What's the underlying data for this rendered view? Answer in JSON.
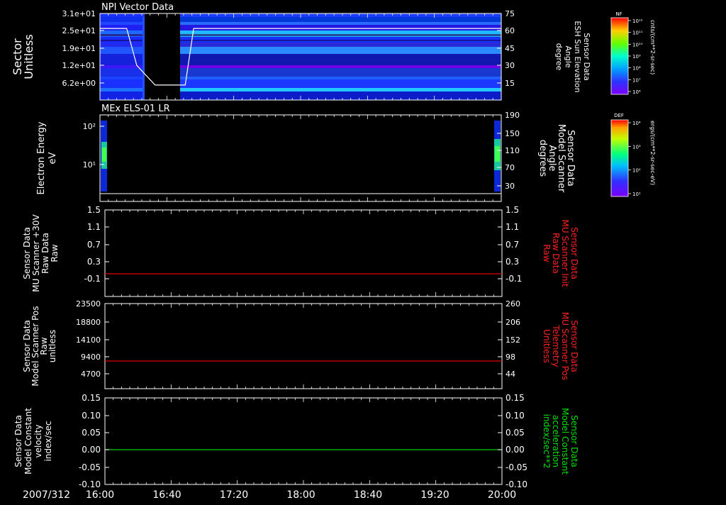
{
  "date_label": "2007/312",
  "time_ticks": [
    "16:00",
    "16:40",
    "17:20",
    "18:00",
    "18:40",
    "19:20",
    "20:00"
  ],
  "colors": {
    "background": "#000000",
    "axes": "#ffffff",
    "red_line": "#dd0000",
    "green_line": "#00cc00",
    "red_label": "#ff2020",
    "green_label": "#00e000"
  },
  "colorbars": [
    {
      "title": "NF",
      "ticks": [
        "10¹²",
        "10¹¹",
        "10¹⁰",
        "10⁹",
        "10⁸",
        "10⁷",
        "10⁶"
      ],
      "unit": "cnts/(cm**2-sr-sec)"
    },
    {
      "title": "DEF",
      "ticks": [
        "10⁴",
        "10³",
        "10²",
        "10¹"
      ],
      "unit": "ergs/(cm**2-sr-sec-eV)"
    }
  ],
  "panels": [
    {
      "title": "NPI Vector Data",
      "left_label": [
        "Sector",
        "Unitless"
      ],
      "left_ticks": [
        "3.1e+01",
        "2.5e+01",
        "1.9e+01",
        "1.2e+01",
        "6.2e+00"
      ],
      "right_ticks": [
        "75",
        "60",
        "45",
        "30",
        "15"
      ],
      "right_label": [
        "Sensor Data",
        "ESH Sun Elevation",
        "Angle",
        "degree"
      ]
    },
    {
      "title": "MEx ELS-01 LR",
      "left_label": [
        "Electron Energy",
        "eV"
      ],
      "left_ticks": [
        "10²",
        "10¹"
      ],
      "right_ticks": [
        "190",
        "150",
        "110",
        "70",
        "30"
      ],
      "right_label": [
        "Sensor Data",
        "Model Scanner",
        "Angle",
        "degrees"
      ]
    },
    {
      "title": "",
      "left_label": [
        "Sensor Data",
        "MU Scanner +30V",
        "Raw Data",
        "Raw"
      ],
      "left_ticks": [
        "1.5",
        "1.1",
        "0.7",
        "0.3",
        "-0.1"
      ],
      "right_ticks": [
        "1.5",
        "1.1",
        "0.7",
        "0.3",
        "-0.1"
      ],
      "right_label": [
        "Sensor Data",
        "MU Scanner Init",
        "Raw Data",
        "Raw"
      ]
    },
    {
      "title": "",
      "left_label": [
        "Sensor Data",
        "Model Scanner Pos",
        "Raw",
        "unitless"
      ],
      "left_ticks": [
        "23500",
        "18800",
        "14100",
        "9400",
        "4700"
      ],
      "right_ticks": [
        "260",
        "206",
        "152",
        "98",
        "44"
      ],
      "right_label": [
        "Sensor Data",
        "MU Scanner Pos",
        "Telemetry",
        "Unitless"
      ]
    },
    {
      "title": "",
      "left_label": [
        "Sensor Data",
        "Model Constant",
        "velocity",
        "index/sec"
      ],
      "left_ticks": [
        "0.15",
        "0.10",
        "0.05",
        "0.00",
        "-0.05",
        "-0.10"
      ],
      "right_ticks": [
        "0.15",
        "0.10",
        "0.05",
        "0.00",
        "-0.05",
        "-0.10"
      ],
      "right_label": [
        "Sensor Data",
        "Model Constant",
        "acceleration",
        "index/sec**2"
      ]
    }
  ],
  "chart_data": {
    "type": "line",
    "x_range": [
      "16:00",
      "20:00"
    ],
    "date": "2007/312",
    "panels": [
      {
        "name": "NPI Vector Data",
        "kind": "spectrogram",
        "ylim": [
          0,
          32
        ],
        "y2lim": [
          0,
          75
        ],
        "gap": [
          "16:20",
          "16:52"
        ],
        "line_series": {
          "x": [
            "16:00",
            "16:16",
            "16:22",
            "16:33",
            "16:40",
            "16:51",
            "16:56",
            "20:00"
          ],
          "y2": [
            62,
            62,
            30,
            13,
            13,
            13,
            62,
            62
          ]
        }
      },
      {
        "name": "MEx ELS-01 LR",
        "kind": "spectrogram",
        "yscale": "log",
        "active_intervals": [
          [
            "16:00",
            "16:05"
          ],
          [
            "19:56",
            "20:00"
          ]
        ],
        "line_series": {
          "x": [
            "16:00",
            "20:00"
          ],
          "y2": [
            5,
            5
          ]
        }
      },
      {
        "name": "MU Scanner +30V Raw Data",
        "ylim": [
          -0.3,
          1.5
        ],
        "x": [
          "16:00",
          "20:00"
        ],
        "y": [
          0,
          0
        ]
      },
      {
        "name": "Model Scanner Pos",
        "ylim": [
          0,
          23500
        ],
        "x": [
          "16:00",
          "20:00"
        ],
        "y": [
          8100,
          8100
        ]
      },
      {
        "name": "Model Constant velocity",
        "ylim": [
          -0.1,
          0.15
        ],
        "x": [
          "16:00",
          "20:00"
        ],
        "y": [
          0,
          0
        ]
      }
    ]
  }
}
